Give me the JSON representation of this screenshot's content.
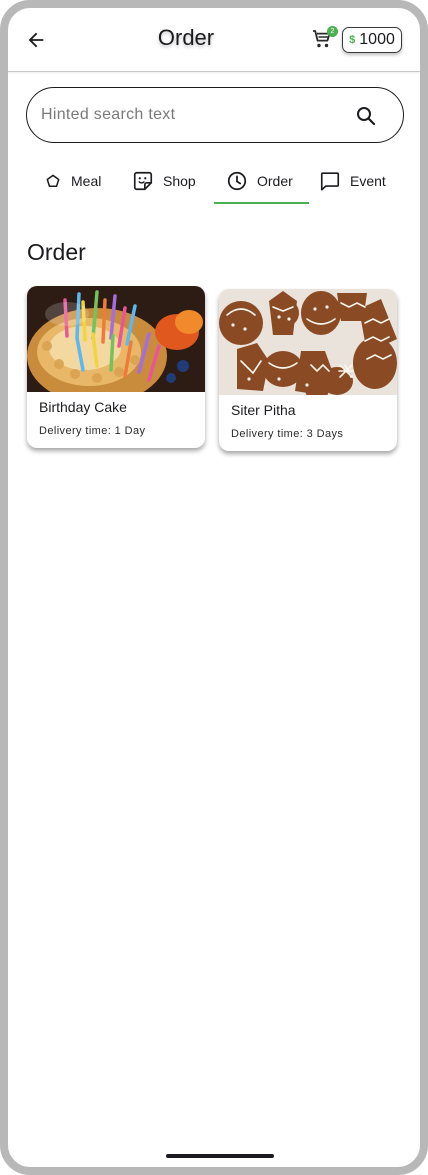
{
  "app_bar": {
    "title": "Order",
    "cart_badge": "2",
    "coin_symbol": "$",
    "coin_balance": "1000"
  },
  "search": {
    "placeholder": "Hinted search text",
    "value": ""
  },
  "tabs": [
    {
      "label": "Meal",
      "icon": "pentagon-icon"
    },
    {
      "label": "Shop",
      "icon": "sticker-icon"
    },
    {
      "label": "Order",
      "icon": "clock-icon",
      "selected": true
    },
    {
      "label": "Event",
      "icon": "chat-bubble-icon"
    }
  ],
  "section": {
    "title": "Order"
  },
  "orders": [
    {
      "name": "Birthday Cake",
      "delivery": "Delivery time: 1 Day",
      "image": "birthday-cake-photo"
    },
    {
      "name": "Siter Pitha",
      "delivery": "Delivery time: 3 Days",
      "image": "gingerbread-cookies-photo"
    }
  ],
  "colors": {
    "accent": "#4caf50",
    "text": "#1c1b1f",
    "frame": "#b8b8b8"
  }
}
